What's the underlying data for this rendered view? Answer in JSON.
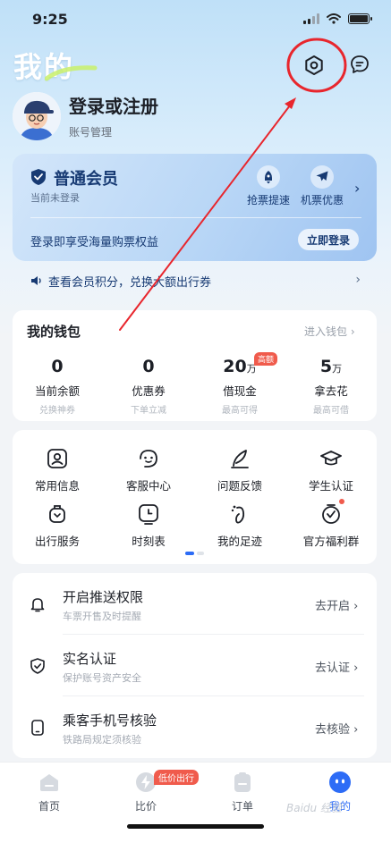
{
  "status_bar": {
    "time": "9:25"
  },
  "header": {
    "title": "我的"
  },
  "user": {
    "login_title": "登录或注册",
    "subtitle": "账号管理"
  },
  "member": {
    "name": "普通会员",
    "status": "当前未登录",
    "perks": [
      {
        "label": "抢票提速"
      },
      {
        "label": "机票优惠"
      }
    ],
    "benefit": "登录即享受海量购票权益",
    "login_button": "立即登录"
  },
  "points_bar": {
    "text": "查看会员积分，兑换大额出行券"
  },
  "wallet": {
    "title": "我的钱包",
    "link": "进入钱包",
    "items": [
      {
        "value": "0",
        "unit": "",
        "label": "当前余额",
        "sub": "兑换神券"
      },
      {
        "value": "0",
        "unit": "",
        "label": "优惠券",
        "sub": "下单立减"
      },
      {
        "value": "20",
        "unit": "万",
        "label": "借现金",
        "sub": "最高可得",
        "badge": "高额"
      },
      {
        "value": "5",
        "unit": "万",
        "label": "拿去花",
        "sub": "最高可借"
      }
    ]
  },
  "services": [
    {
      "label": "常用信息"
    },
    {
      "label": "客服中心"
    },
    {
      "label": "问题反馈"
    },
    {
      "label": "学生认证"
    },
    {
      "label": "出行服务"
    },
    {
      "label": "时刻表"
    },
    {
      "label": "我的足迹"
    },
    {
      "label": "官方福利群"
    }
  ],
  "settings_rows": [
    {
      "title": "开启推送权限",
      "subtitle": "车票开售及时提醒",
      "action": "去开启"
    },
    {
      "title": "实名认证",
      "subtitle": "保护账号资产安全",
      "action": "去认证"
    },
    {
      "title": "乘客手机号核验",
      "subtitle": "铁路局规定须核验",
      "action": "去核验"
    }
  ],
  "tabbar": {
    "tabs": [
      {
        "label": "首页"
      },
      {
        "label": "比价"
      },
      {
        "label": "订单"
      },
      {
        "label": "我的"
      }
    ],
    "badge": "低价出行",
    "active_index": 3
  },
  "watermark": "Baidu 经验",
  "colors": {
    "accent": "#2d6cf6",
    "annotation": "#e8262d",
    "badge": "#f05b4c",
    "member_text": "#173a73"
  }
}
